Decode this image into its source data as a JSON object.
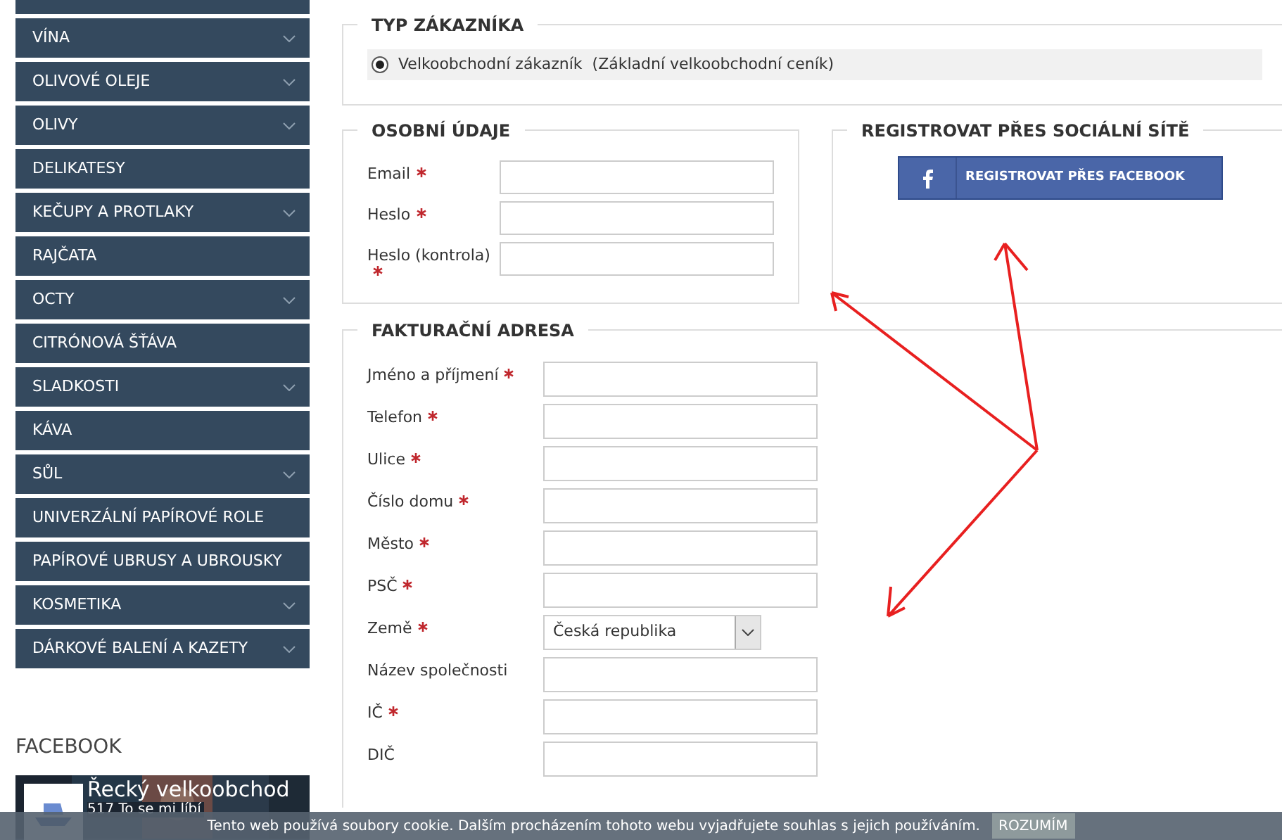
{
  "sidebar": {
    "items": [
      {
        "label": "VÍNA",
        "expandable": true
      },
      {
        "label": "OLIVOVÉ OLEJE",
        "expandable": true
      },
      {
        "label": "OLIVY",
        "expandable": true
      },
      {
        "label": "DELIKATESY",
        "expandable": false
      },
      {
        "label": "KEČUPY A PROTLAKY",
        "expandable": true
      },
      {
        "label": "RAJČATA",
        "expandable": false
      },
      {
        "label": "OCTY",
        "expandable": true
      },
      {
        "label": "CITRÓNOVÁ ŠŤÁVA",
        "expandable": false
      },
      {
        "label": "SLADKOSTI",
        "expandable": true
      },
      {
        "label": "KÁVA",
        "expandable": false
      },
      {
        "label": "SŮL",
        "expandable": true
      },
      {
        "label": "UNIVERZÁLNÍ PAPÍROVÉ ROLE",
        "expandable": false
      },
      {
        "label": "PAPÍROVÉ UBRUSY A UBROUSKY",
        "expandable": false
      },
      {
        "label": "KOSMETIKA",
        "expandable": true
      },
      {
        "label": "DÁRKOVÉ BALENÍ A KAZETY",
        "expandable": true
      }
    ],
    "facebook": {
      "heading": "FACEBOOK",
      "page_name": "Řecký velkoobchod",
      "likes": "517 To se mi líbí"
    }
  },
  "customer_type": {
    "legend": "TYP ZÁKAZNÍKA",
    "options": [
      {
        "label": "Velkoobchodní zákazník",
        "note": "(Základní velkoobchodní ceník)",
        "selected": true
      }
    ]
  },
  "personal": {
    "legend": "OSOBNÍ ÚDAJE",
    "fields": [
      {
        "label": "Email",
        "required": true
      },
      {
        "label": "Heslo",
        "required": true
      },
      {
        "label": "Heslo (kontrola)",
        "required": true
      }
    ]
  },
  "social": {
    "legend": "REGISTROVAT PŘES SOCIÁLNÍ SÍTĚ",
    "button": "REGISTROVAT PŘES FACEBOOK"
  },
  "billing": {
    "legend": "FAKTURAČNÍ ADRESA",
    "fields": [
      {
        "label": "Jméno a příjmení",
        "required": true,
        "kind": "text"
      },
      {
        "label": "Telefon",
        "required": true,
        "kind": "text"
      },
      {
        "label": "Ulice",
        "required": true,
        "kind": "text"
      },
      {
        "label": "Číslo domu",
        "required": true,
        "kind": "text"
      },
      {
        "label": "Město",
        "required": true,
        "kind": "text"
      },
      {
        "label": "PSČ",
        "required": true,
        "kind": "text"
      },
      {
        "label": "Země",
        "required": true,
        "kind": "select",
        "value": "Česká republika"
      },
      {
        "label": "Název společnosti",
        "required": false,
        "kind": "text"
      },
      {
        "label": "IČ",
        "required": true,
        "kind": "text"
      },
      {
        "label": "DIČ",
        "required": false,
        "kind": "text"
      }
    ]
  },
  "cookie_bar": {
    "text": "Tento web používá soubory cookie. Dalším procházením tohoto webu vyjadřujete souhlas s jejich používáním.",
    "button": "ROZUMÍM"
  }
}
